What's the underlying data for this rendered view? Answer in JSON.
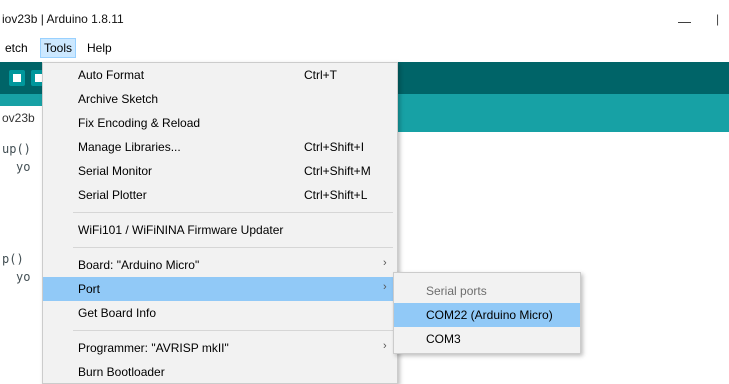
{
  "window": {
    "title": "iov23b | Arduino 1.8.11",
    "minimize_glyph": "—",
    "maximize_glyph": "|"
  },
  "menubar": {
    "items": [
      {
        "label": "etch"
      },
      {
        "label": "Tools"
      },
      {
        "label": "Help"
      }
    ]
  },
  "tab": {
    "label": "ov23b"
  },
  "editor": {
    "lines": [
      "up()",
      "yo",
      "p()",
      "yo"
    ]
  },
  "tools_menu": {
    "items": [
      {
        "label": "Auto Format",
        "shortcut": "Ctrl+T"
      },
      {
        "label": "Archive Sketch",
        "shortcut": ""
      },
      {
        "label": "Fix Encoding & Reload",
        "shortcut": ""
      },
      {
        "label": "Manage Libraries...",
        "shortcut": "Ctrl+Shift+I"
      },
      {
        "label": "Serial Monitor",
        "shortcut": "Ctrl+Shift+M"
      },
      {
        "label": "Serial Plotter",
        "shortcut": "Ctrl+Shift+L"
      },
      {
        "label": "WiFi101 / WiFiNINA Firmware Updater",
        "shortcut": ""
      },
      {
        "label": "Board: \"Arduino Micro\"",
        "shortcut": "",
        "arrow": "›"
      },
      {
        "label": "Port",
        "shortcut": "",
        "arrow": "›",
        "highlighted": true
      },
      {
        "label": "Get Board Info",
        "shortcut": ""
      },
      {
        "label": "Programmer: \"AVRISP mkII\"",
        "shortcut": "",
        "arrow": "›"
      },
      {
        "label": "Burn Bootloader",
        "shortcut": ""
      }
    ]
  },
  "port_submenu": {
    "header": "Serial ports",
    "items": [
      {
        "label": "COM22 (Arduino Micro)",
        "highlighted": true
      },
      {
        "label": "COM3"
      }
    ]
  },
  "colors": {
    "toolbar": "#006468",
    "tabbar": "#17a1a5",
    "menu_bg": "#f2f2f2",
    "highlight": "#91c9f7"
  }
}
